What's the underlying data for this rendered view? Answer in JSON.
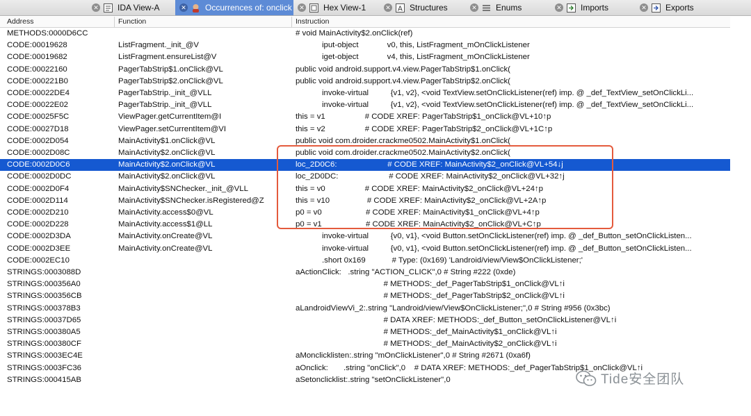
{
  "tabs": [
    {
      "label": "IDA View-A",
      "icon": "ida-view-icon",
      "active": false
    },
    {
      "label": "Occurrences of: onclick",
      "icon": "occurrences-icon",
      "active": true
    },
    {
      "label": "Hex View-1",
      "icon": "hex-view-icon",
      "active": false
    },
    {
      "label": "Structures",
      "icon": "structures-icon",
      "active": false
    },
    {
      "label": "Enums",
      "icon": "enums-icon",
      "active": false
    },
    {
      "label": "Imports",
      "icon": "imports-icon",
      "active": false
    },
    {
      "label": "Exports",
      "icon": "exports-icon",
      "active": false
    }
  ],
  "columns": {
    "address": "Address",
    "function": "Function",
    "instruction": "Instruction"
  },
  "rows": [
    {
      "address": "METHODS:0000D6CC",
      "function": "",
      "instruction": "# void MainActivity$2.onClick(ref)"
    },
    {
      "address": "CODE:00019628",
      "function": "ListFragment._init_@V",
      "instruction": "            iput-object             v0, this, ListFragment_mOnClickListener"
    },
    {
      "address": "CODE:00019682",
      "function": "ListFragment.ensureList@V",
      "instruction": "            iget-object             v4, this, ListFragment_mOnClickListener"
    },
    {
      "address": "CODE:00022160",
      "function": "PagerTabStrip$1.onClick@VL",
      "instruction": "public void android.support.v4.view.PagerTabStrip$1.onClick("
    },
    {
      "address": "CODE:000221B0",
      "function": "PagerTabStrip$2.onClick@VL",
      "instruction": "public void android.support.v4.view.PagerTabStrip$2.onClick("
    },
    {
      "address": "CODE:00022DE4",
      "function": "PagerTabStrip._init_@VLL",
      "instruction": "            invoke-virtual          {v1, v2}, <void TextView.setOnClickListener(ref) imp. @ _def_TextView_setOnClickLi..."
    },
    {
      "address": "CODE:00022E02",
      "function": "PagerTabStrip._init_@VLL",
      "instruction": "            invoke-virtual          {v1, v2}, <void TextView.setOnClickListener(ref) imp. @ _def_TextView_setOnClickLi..."
    },
    {
      "address": "CODE:00025F5C",
      "function": "ViewPager.getCurrentItem@I",
      "instruction": "this = v1                  # CODE XREF: PagerTabStrip$1_onClick@VL+10↑p"
    },
    {
      "address": "CODE:00027D18",
      "function": "ViewPager.setCurrentItem@VI",
      "instruction": "this = v2                  # CODE XREF: PagerTabStrip$2_onClick@VL+1C↑p"
    },
    {
      "address": "CODE:0002D054",
      "function": "MainActivity$1.onClick@VL",
      "instruction": "public void com.droider.crackme0502.MainActivity$1.onClick("
    },
    {
      "address": "CODE:0002D08C",
      "function": "MainActivity$2.onClick@VL",
      "instruction": "public void com.droider.crackme0502.MainActivity$2.onClick("
    },
    {
      "address": "CODE:0002D0C6",
      "function": "MainActivity$2.onClick@VL",
      "instruction": "loc_2D0C6:                       # CODE XREF: MainActivity$2_onClick@VL+54↓j"
    },
    {
      "address": "CODE:0002D0DC",
      "function": "MainActivity$2.onClick@VL",
      "instruction": "loc_2D0DC:                       # CODE XREF: MainActivity$2_onClick@VL+32↑j"
    },
    {
      "address": "CODE:0002D0F4",
      "function": "MainActivity$SNChecker._init_@VLL",
      "instruction": "this = v0                  # CODE XREF: MainActivity$2_onClick@VL+24↑p"
    },
    {
      "address": "CODE:0002D114",
      "function": "MainActivity$SNChecker.isRegistered@Z",
      "instruction": "this = v10                 # CODE XREF: MainActivity$2_onClick@VL+2A↑p"
    },
    {
      "address": "CODE:0002D210",
      "function": "MainActivity.access$0@VL",
      "instruction": "p0 = v0                    # CODE XREF: MainActivity$1_onClick@VL+4↑p"
    },
    {
      "address": "CODE:0002D228",
      "function": "MainActivity.access$1@LL",
      "instruction": "p0 = v1                    # CODE XREF: MainActivity$2_onClick@VL+C↑p"
    },
    {
      "address": "CODE:0002D3DA",
      "function": "MainActivity.onCreate@VL",
      "instruction": "            invoke-virtual          {v0, v1}, <void Button.setOnClickListener(ref) imp. @ _def_Button_setOnClickListen..."
    },
    {
      "address": "CODE:0002D3EE",
      "function": "MainActivity.onCreate@VL",
      "instruction": "            invoke-virtual          {v0, v1}, <void Button.setOnClickListener(ref) imp. @ _def_Button_setOnClickListen..."
    },
    {
      "address": "CODE:0002EC10",
      "function": "",
      "instruction": "            .short 0x169            # Type: (0x169) 'Landroid/view/View$OnClickListener;'"
    },
    {
      "address": "STRINGS:0003088D",
      "function": "",
      "instruction": "aActionClick:   .string \"ACTION_CLICK\",0 # String #222 (0xde)"
    },
    {
      "address": "STRINGS:000356A0",
      "function": "",
      "instruction": "                                        # METHODS:_def_PagerTabStrip$1_onClick@VL↑i"
    },
    {
      "address": "STRINGS:000356CB",
      "function": "",
      "instruction": "                                        # METHODS:_def_PagerTabStrip$2_onClick@VL↑i"
    },
    {
      "address": "STRINGS:000378B3",
      "function": "",
      "instruction": "aLandroidViewVi_2:.string \"Landroid/view/View$OnClickListener;\",0 # String #956 (0x3bc)"
    },
    {
      "address": "STRINGS:00037D65",
      "function": "",
      "instruction": "                                        # DATA XREF: METHODS:_def_Button_setOnClickListener@VL↑i"
    },
    {
      "address": "STRINGS:000380A5",
      "function": "",
      "instruction": "                                        # METHODS:_def_MainActivity$1_onClick@VL↑i"
    },
    {
      "address": "STRINGS:000380CF",
      "function": "",
      "instruction": "                                        # METHODS:_def_MainActivity$2_onClick@VL↑i"
    },
    {
      "address": "STRINGS:0003EC4E",
      "function": "",
      "instruction": "aMonclicklisten:.string \"mOnClickListener\",0 # String #2671 (0xa6f)"
    },
    {
      "address": "STRINGS:0003FC36",
      "function": "",
      "instruction": "aOnclick:       .string \"onClick\",0    # DATA XREF: METHODS:_def_PagerTabStrip$1_onClick@VL↑i"
    },
    {
      "address": "STRINGS:000415AB",
      "function": "",
      "instruction": "aSetonclicklist:.string \"setOnClickListener\",0"
    }
  ],
  "selected_row_index": 11,
  "watermark": {
    "text": "Tide安全团队",
    "icon": "wechat-icon"
  },
  "colors": {
    "selection": "#1559d1",
    "active_tab": "#5d8bd6",
    "highlight_box": "#e45a3c"
  }
}
